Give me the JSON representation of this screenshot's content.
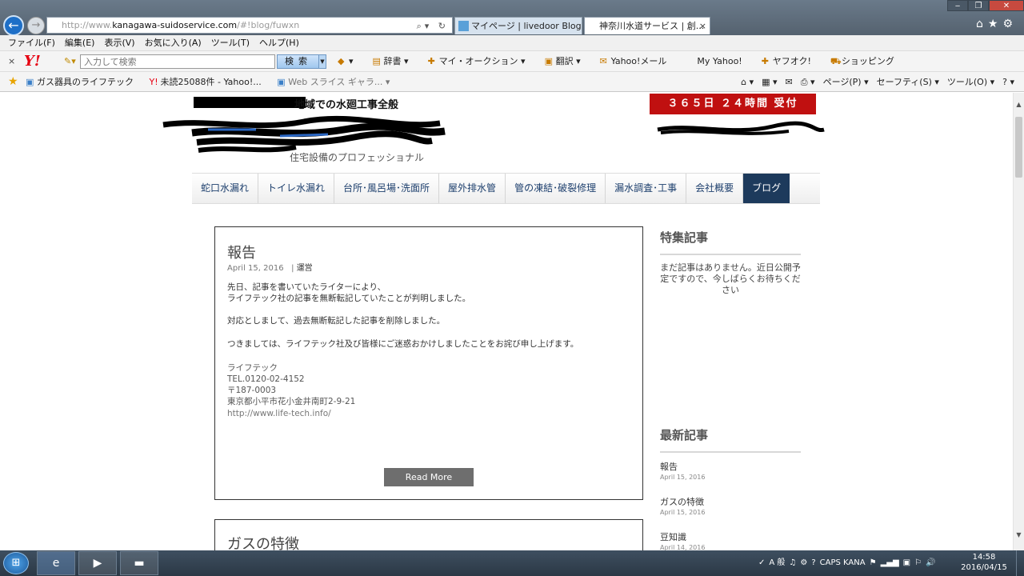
{
  "browser": {
    "url_prefix": "http://www.",
    "url_domain": "kanagawa-suidoservice.com",
    "url_path": "/#!blog/fuwxn",
    "addr_tools": "⌕▾ ↻",
    "tabs": [
      {
        "label": "マイページ | livedoor Blog"
      },
      {
        "label": "神奈川水道サービス | 創..."
      }
    ],
    "tab_close": "×",
    "window_buttons": {
      "minimize": "‒",
      "maximize": "❐",
      "close": "✕"
    },
    "right_icons": "⌂★⚙"
  },
  "menubar": [
    "ファイル(F)",
    "編集(E)",
    "表示(V)",
    "お気に入り(A)",
    "ツール(T)",
    "ヘルプ(H)"
  ],
  "yahoo_toolbar": {
    "close": "×",
    "logo": "Y!",
    "search_placeholder": "入力して検索",
    "search_button": "検索",
    "links": [
      {
        "icon": "shield-icon",
        "glyph": "◆",
        "label": "▾"
      },
      {
        "icon": "dictionary-icon",
        "glyph": "▤",
        "label": "辞書 ▾"
      },
      {
        "icon": "my-auction-icon",
        "glyph": "✚",
        "label": "マイ・オークション ▾"
      },
      {
        "icon": "translate-icon",
        "glyph": "▣",
        "label": "翻訳 ▾"
      },
      {
        "icon": "mail-icon",
        "glyph": "✉",
        "label": "Yahoo!メール"
      },
      {
        "icon": "my-yahoo-icon",
        "glyph": "",
        "label": "My Yahoo!"
      },
      {
        "icon": "auction-icon",
        "glyph": "✚",
        "label": "ヤフオク!"
      },
      {
        "icon": "shopping-cart-icon",
        "glyph": "⛟",
        "label": "ショッピング"
      }
    ]
  },
  "favorites_bar": {
    "items": [
      {
        "label": "ガス器具のライフテック"
      },
      {
        "label": "未読25088件 - Yahoo!..."
      },
      {
        "label": "Web スライス ギャラ... ▾"
      }
    ],
    "tools": [
      "⌂ ▾",
      "▦ ▾",
      "✉",
      "⎙ ▾",
      "ページ(P) ▾",
      "セーフティ(S) ▾",
      "ツール(O) ▾",
      "? ▾"
    ]
  },
  "site": {
    "tagline": "地域での水廻工事全般",
    "subtagline": "住宅設備のプロフェッショナル",
    "hours_badge": "３６５日 ２４時間 受付",
    "colors": {
      "accent": "#1d3a5c",
      "badge": "#c01010"
    }
  },
  "nav": [
    {
      "label": "蛇口水漏れ",
      "active": false
    },
    {
      "label": "トイレ水漏れ",
      "active": false
    },
    {
      "label": "台所･風呂場･洗面所",
      "active": false
    },
    {
      "label": "屋外排水管",
      "active": false
    },
    {
      "label": "管の凍結･破裂修理",
      "active": false
    },
    {
      "label": "漏水調査･工事",
      "active": false
    },
    {
      "label": "会社概要",
      "active": false
    },
    {
      "label": "ブログ",
      "active": true
    }
  ],
  "posts": [
    {
      "title": "報告",
      "date": "April 15, 2016",
      "separator": "|",
      "category": "運営",
      "paragraphs": [
        "先日、記事を書いていたライターにより、",
        "ライフテック社の記事を無断転記していたことが判明しました。",
        "対応としまして、過去無断転記した記事を削除しました。",
        "つきましては、ライフテック社及び皆様にご迷惑おかけしましたことをお詫び申し上げます。"
      ],
      "signature": {
        "company": "ライフテック",
        "tel": "TEL.0120-02-4152",
        "zip": "〒187-0003",
        "address": "東京都小平市花小金井南町2-9-21",
        "url": "http://www.life-tech.info/"
      },
      "read_more": "Read More"
    },
    {
      "title": "ガスの特徴"
    }
  ],
  "sidebar": {
    "featured_heading": "特集記事",
    "featured_empty": "まだ記事はありません。近日公開予定ですので、今しばらくお待ちください",
    "recent_heading": "最新記事",
    "recent": [
      {
        "title": "報告",
        "date": "April 15, 2016"
      },
      {
        "title": "ガスの特徴",
        "date": "April 15, 2016"
      },
      {
        "title": "豆知識",
        "date": "April 14, 2016"
      }
    ]
  },
  "scrollbar": {
    "up": "▲",
    "down": "▼"
  },
  "taskbar": {
    "start": "⊞",
    "apps": [
      {
        "name": "ie",
        "glyph": "e"
      },
      {
        "name": "media-player",
        "glyph": "▶"
      },
      {
        "name": "explorer",
        "glyph": "▬"
      }
    ],
    "tray": [
      "✓",
      "A 般",
      "♫",
      "⚙",
      "?",
      "CAPS KANA",
      "⚑",
      "▂▄▆",
      "▣",
      "⚐",
      "🔊"
    ],
    "time": "14:58",
    "date": "2016/04/15"
  }
}
